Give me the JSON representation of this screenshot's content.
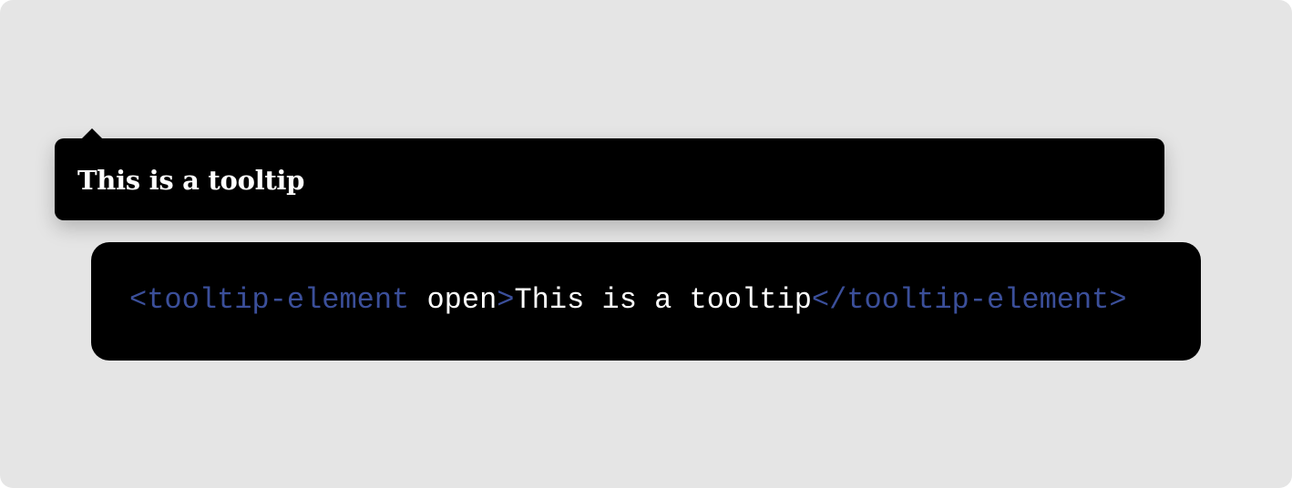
{
  "tooltip": {
    "text": "This is a tooltip"
  },
  "code": {
    "open_tag_start": "<tooltip-element",
    "space": " ",
    "attribute": "open",
    "open_tag_end": ">",
    "content": "This is a tooltip",
    "close_tag": "</tooltip-element>"
  },
  "colors": {
    "background": "#e5e5e5",
    "surface": "#000000",
    "text": "#ffffff",
    "tag": "#3b4f9a"
  }
}
